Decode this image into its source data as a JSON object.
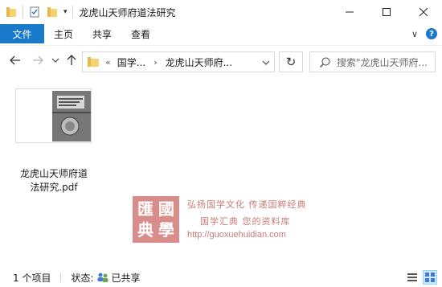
{
  "window": {
    "title": "龙虎山天师府道法研究",
    "minimize_glyph": "—",
    "maximize_glyph": "☐",
    "close_glyph": "✕"
  },
  "quick_access": {
    "icons": [
      "folder-icon",
      "properties-icon",
      "new-folder-icon"
    ],
    "dropdown_glyph": "▾"
  },
  "ribbon": {
    "file_tab": "文件",
    "tabs": [
      "主页",
      "共享",
      "查看"
    ],
    "collapse_glyph": "∨",
    "help_glyph": "?"
  },
  "nav": {
    "back_glyph": "←",
    "forward_glyph": "→",
    "recent_glyph": "∨",
    "up_glyph": "↑",
    "overflow_glyph": "«",
    "breadcrumb": [
      "国学...",
      "龙虎山天师府..."
    ],
    "separator_glyph": "›",
    "refresh_glyph": "↻",
    "search_placeholder": "搜索\"龙虎山天师府..."
  },
  "files": [
    {
      "name": "龙虎山天师府道法研究.pdf",
      "name_line1": "龙虎山天师府道",
      "name_line2": "法研究.pdf"
    }
  ],
  "watermark": {
    "seal_chars": [
      "匯",
      "國",
      "典",
      "學"
    ],
    "line1": "弘扬国学文化  传递国粹经典",
    "line2": "国学汇典  您的资料库",
    "url": "http://guoxuehuidian.com"
  },
  "status": {
    "item_count": "1 个项目",
    "state_label": "状态:",
    "state_value": "已共享"
  },
  "colors": {
    "accent": "#1979ca",
    "watermark": "#d98d8a"
  }
}
